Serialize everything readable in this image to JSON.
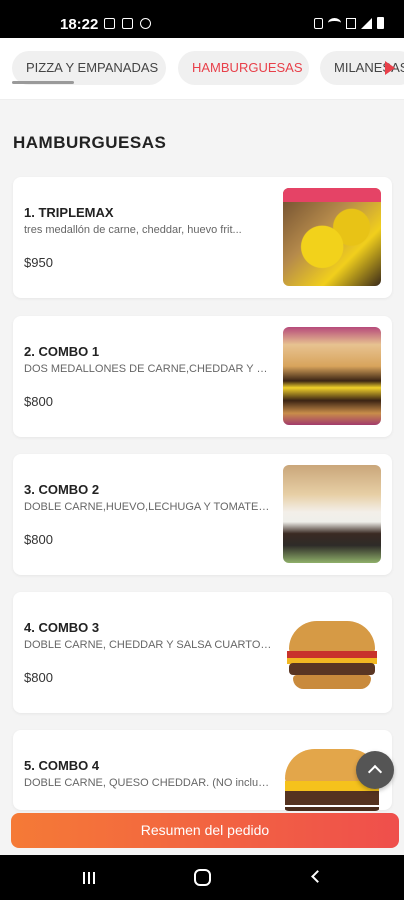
{
  "status_bar": {
    "time": "18:22"
  },
  "categories": [
    {
      "label": "PIZZA Y EMPANADAS",
      "active": false
    },
    {
      "label": "HAMBURGUESAS",
      "active": true
    },
    {
      "label": "MILANESAS",
      "active": false
    }
  ],
  "section_title": "HAMBURGUESAS",
  "products": [
    {
      "name": "1. TRIPLEMAX",
      "description": "tres medallón de carne, cheddar, huevo frit...",
      "price": "$950"
    },
    {
      "name": "2. COMBO 1",
      "description": "DOS MEDALLONES DE CARNE,CHEDDAR Y BAC...",
      "price": "$800"
    },
    {
      "name": "3. COMBO 2",
      "description": "DOBLE CARNE,HUEVO,LECHUGA Y TOMATE. (N...",
      "price": "$800"
    },
    {
      "name": "4. COMBO 3",
      "description": "DOBLE CARNE, CHEDDAR Y SALSA CUARTO DE ...",
      "price": "$800"
    },
    {
      "name": "5. COMBO 4",
      "description": "DOBLE CARNE, QUESO CHEDDAR. (NO incluye ...",
      "price": ""
    }
  ],
  "order_button": "Resumen del pedido",
  "colors": {
    "accent": "#e8404a",
    "button_start": "#f57a36",
    "button_end": "#ef4f4c"
  }
}
